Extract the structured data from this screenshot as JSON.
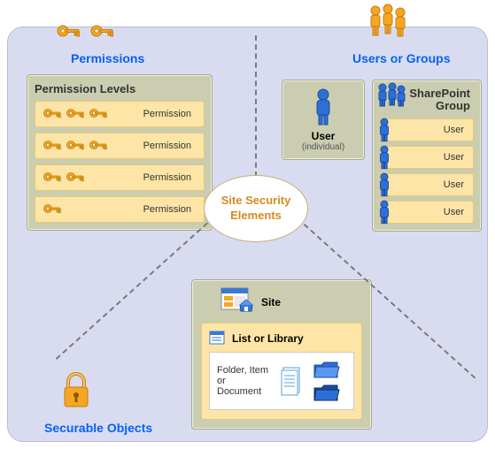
{
  "center_label": "Site Security Elements",
  "sections": {
    "permissions": "Permissions",
    "users_groups": "Users or Groups",
    "securable_objects": "Securable Objects"
  },
  "permission_levels": {
    "title": "Permission Levels",
    "rows": [
      {
        "label": "Permission",
        "keys": 3
      },
      {
        "label": "Permission",
        "keys": 3
      },
      {
        "label": "Permission",
        "keys": 2
      },
      {
        "label": "Permission",
        "keys": 1
      }
    ]
  },
  "user_individual": {
    "title": "User",
    "subtitle": "(individual)"
  },
  "sharepoint_group": {
    "title": "SharePoint Group",
    "users": [
      "User",
      "User",
      "User",
      "User"
    ]
  },
  "site": {
    "title": "Site",
    "list_library": {
      "title": "List or Library",
      "folder_label": "Folder, Item or Document"
    }
  },
  "chart_data": {
    "type": "diagram",
    "title": "Site Security Elements",
    "nodes": [
      {
        "id": "center",
        "label": "Site Security Elements"
      },
      {
        "id": "permissions",
        "label": "Permissions",
        "children": [
          {
            "id": "permission_levels",
            "label": "Permission Levels",
            "items": [
              "Permission",
              "Permission",
              "Permission",
              "Permission"
            ]
          }
        ]
      },
      {
        "id": "users_groups",
        "label": "Users or Groups",
        "children": [
          {
            "id": "user",
            "label": "User (individual)"
          },
          {
            "id": "sp_group",
            "label": "SharePoint Group",
            "items": [
              "User",
              "User",
              "User",
              "User"
            ]
          }
        ]
      },
      {
        "id": "securable_objects",
        "label": "Securable Objects",
        "children": [
          {
            "id": "site",
            "label": "Site",
            "children": [
              {
                "id": "list_library",
                "label": "List or Library",
                "children": [
                  {
                    "id": "folder_item_doc",
                    "label": "Folder, Item or Document"
                  }
                ]
              }
            ]
          }
        ]
      }
    ],
    "edges": [
      {
        "from": "center",
        "to": "permissions"
      },
      {
        "from": "center",
        "to": "users_groups"
      },
      {
        "from": "center",
        "to": "securable_objects"
      }
    ]
  }
}
